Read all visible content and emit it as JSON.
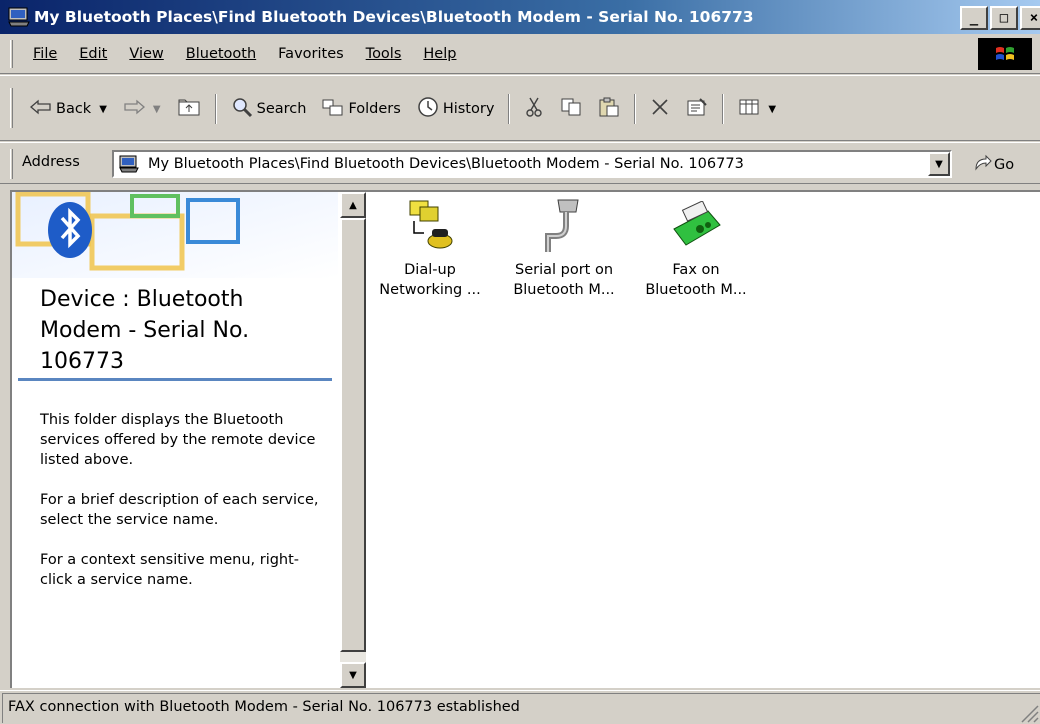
{
  "window": {
    "title": "My Bluetooth Places\\Find Bluetooth Devices\\Bluetooth Modem - Serial No. 106773",
    "minimize_label": "_",
    "maximize_label": "□",
    "close_label": "×"
  },
  "menu": {
    "items": [
      {
        "label": "File",
        "accel": "F"
      },
      {
        "label": "Edit",
        "accel": "E"
      },
      {
        "label": "View",
        "accel": "V"
      },
      {
        "label": "Bluetooth",
        "accel": "B"
      },
      {
        "label": "Favorites",
        "accel": "a"
      },
      {
        "label": "Tools",
        "accel": "T"
      },
      {
        "label": "Help",
        "accel": "H"
      }
    ]
  },
  "toolbar": {
    "back_label": "Back",
    "search_label": "Search",
    "folders_label": "Folders",
    "history_label": "History"
  },
  "address": {
    "label": "Address",
    "value": "My Bluetooth Places\\Find Bluetooth Devices\\Bluetooth Modem - Serial No. 106773",
    "go_label": "Go"
  },
  "left_pane": {
    "device_title": "Device : Bluetooth Modem - Serial No. 106773",
    "paragraphs": [
      "This folder displays the Bluetooth services offered by the remote device listed above.",
      "For a brief description of each service, select the service name.",
      "For a context sensitive menu, right-click a service name."
    ]
  },
  "files": [
    {
      "line1": "Dial-up",
      "line2": "Networking ...",
      "icon": "dialup-networking-icon"
    },
    {
      "line1": "Serial port on",
      "line2": "Bluetooth M...",
      "icon": "serial-port-icon"
    },
    {
      "line1": "Fax on",
      "line2": "Bluetooth M...",
      "icon": "fax-icon"
    }
  ],
  "status": {
    "text": "FAX connection with Bluetooth Modem - Serial No. 106773 established"
  },
  "colors": {
    "title_bar": "#0a246a",
    "bluetooth_blue": "#1e5cc8",
    "divider": "#5a86c0"
  }
}
